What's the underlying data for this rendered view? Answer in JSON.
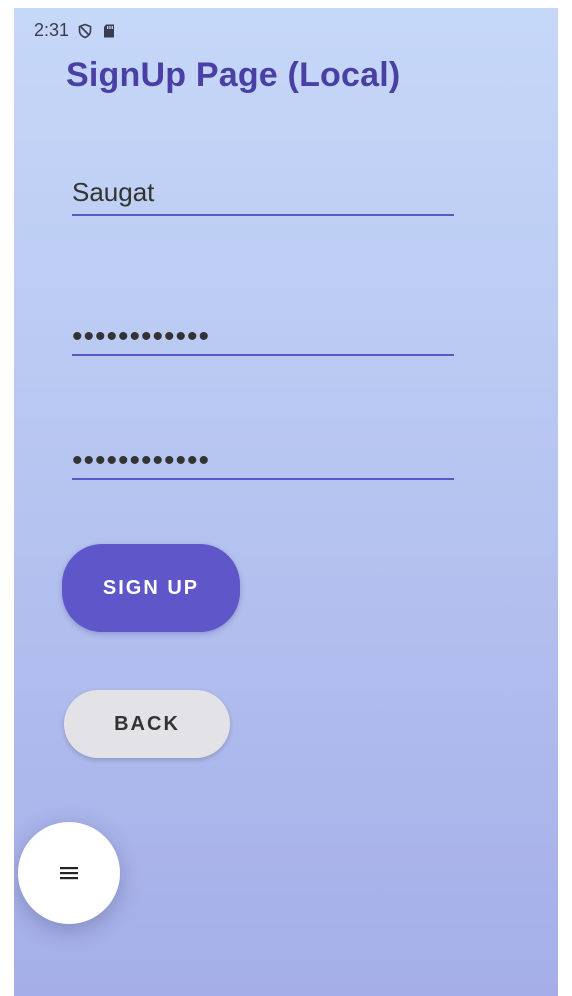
{
  "status_bar": {
    "time": "2:31",
    "icons": [
      "shield-icon",
      "sd-card-icon"
    ]
  },
  "page": {
    "title": "SignUp Page (Local)"
  },
  "form": {
    "username_value": "Saugat",
    "password_value": "••••••••••••",
    "confirm_password_value": "••••••••••••"
  },
  "buttons": {
    "signup_label": "SIGN UP",
    "back_label": "BACK"
  },
  "fab": {
    "icon": "menu-icon"
  },
  "colors": {
    "accent": "#5e56c9",
    "title": "#4a3fa4",
    "secondary_button": "#e2e2e7"
  }
}
